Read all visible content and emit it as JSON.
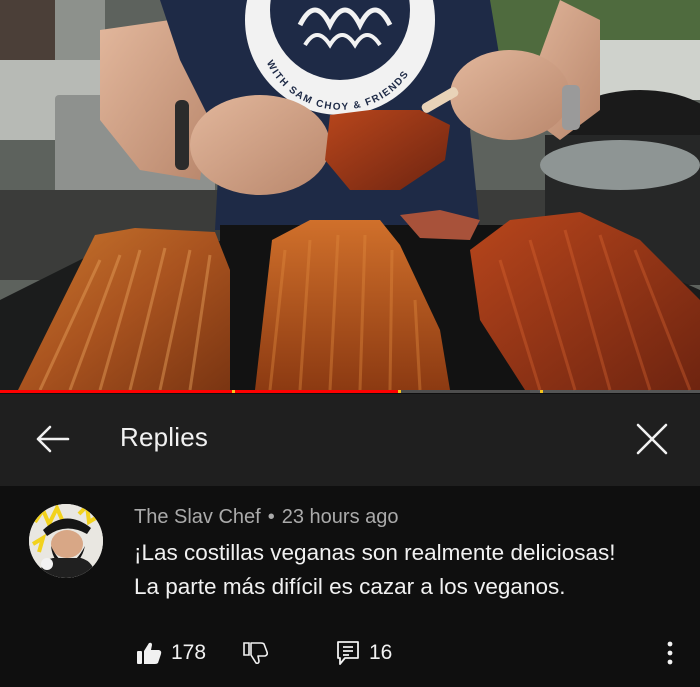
{
  "video": {
    "apron_text": "WITH SAM CHOY & FRIENDS",
    "progress_fraction": 0.57
  },
  "header": {
    "title": "Replies",
    "back_icon": "arrow-left-icon",
    "close_icon": "close-icon"
  },
  "comment": {
    "author": "The Slav Chef",
    "separator": "•",
    "timestamp": "23 hours ago",
    "text_line1": "¡Las costillas veganas son realmente deliciosas!",
    "text_line2": "La parte más difícil es cazar a los veganos.",
    "likes": "178",
    "replies": "16"
  },
  "colors": {
    "background": "#0f0f0f",
    "header_bg": "#1f1f1f",
    "text_primary": "#f1f1f1",
    "text_secondary": "#aaaaaa",
    "progress_red": "#ff0000"
  }
}
